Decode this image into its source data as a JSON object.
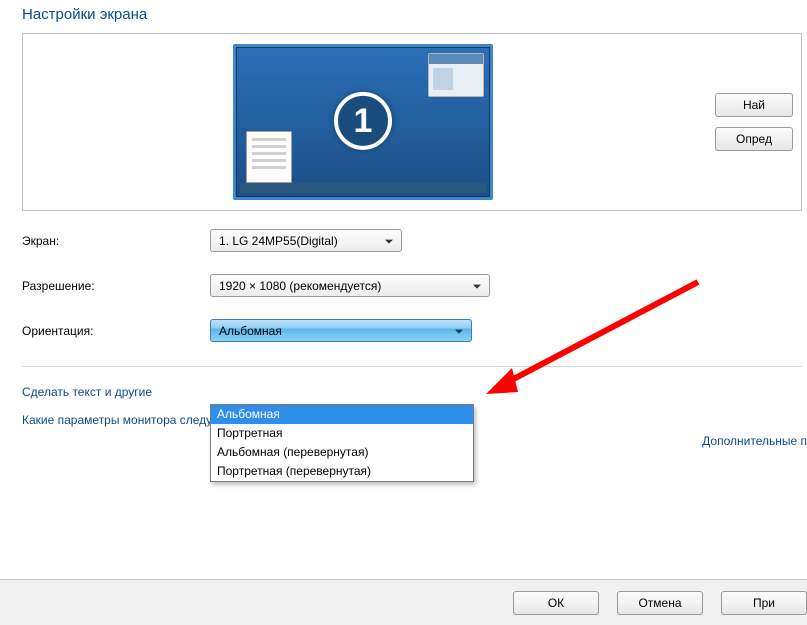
{
  "title": "Настройки экрана",
  "monitor_number": "1",
  "side_buttons": {
    "find": "Най",
    "detect": "Опред"
  },
  "labels": {
    "screen": "Экран:",
    "resolution": "Разрешение:",
    "orientation": "Ориентация:"
  },
  "values": {
    "screen": "1. LG 24MP55(Digital)",
    "resolution": "1920 × 1080 (рекомендуется)",
    "orientation": "Альбомная"
  },
  "orientation_options": [
    "Альбомная",
    "Портретная",
    "Альбомная (перевернутая)",
    "Портретная (перевернутая)"
  ],
  "orientation_selected_index": 0,
  "links": {
    "advanced": "Дополнительные п",
    "textsize": "Сделать текст и другие",
    "whichparams": "Какие параметры монитора следует выбрать?"
  },
  "footer": {
    "ok": "ОК",
    "cancel": "Отмена",
    "apply": "При"
  }
}
